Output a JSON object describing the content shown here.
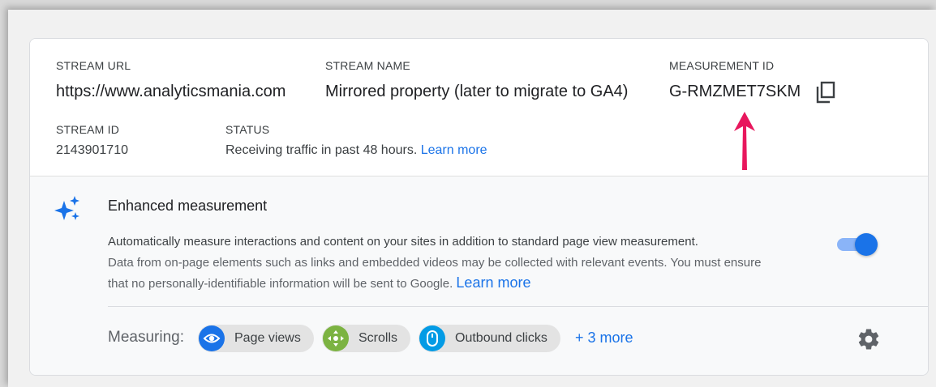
{
  "stream": {
    "url_label": "STREAM URL",
    "url_value": "https://www.analyticsmania.com",
    "name_label": "STREAM NAME",
    "name_value": "Mirrored property (later to migrate to GA4)",
    "measurement_label": "MEASUREMENT ID",
    "measurement_value": "G-RMZMET7SKM",
    "id_label": "STREAM ID",
    "id_value": "2143901710",
    "status_label": "STATUS",
    "status_value": "Receiving traffic in past 48 hours.",
    "status_link": "Learn more"
  },
  "enhanced": {
    "title": "Enhanced measurement",
    "line1": "Automatically measure interactions and content on your sites in addition to standard page view measurement.",
    "line2": "Data from on-page elements such as links and embedded videos may be collected with relevant events. You must ensure",
    "line3": "that no personally-identifiable information will be sent to Google.",
    "learn_more": "Learn more",
    "toggle_on": true,
    "measuring_label": "Measuring:",
    "chips": [
      {
        "label": "Page views",
        "icon": "eye-icon",
        "color": "#1a73e8"
      },
      {
        "label": "Scrolls",
        "icon": "scroll-icon",
        "color": "#7cb342"
      },
      {
        "label": "Outbound clicks",
        "icon": "mouse-icon",
        "color": "#039be5"
      }
    ],
    "more_label": "+ 3 more"
  },
  "colors": {
    "accent": "#1a73e8",
    "annotation_arrow": "#e8175d"
  }
}
